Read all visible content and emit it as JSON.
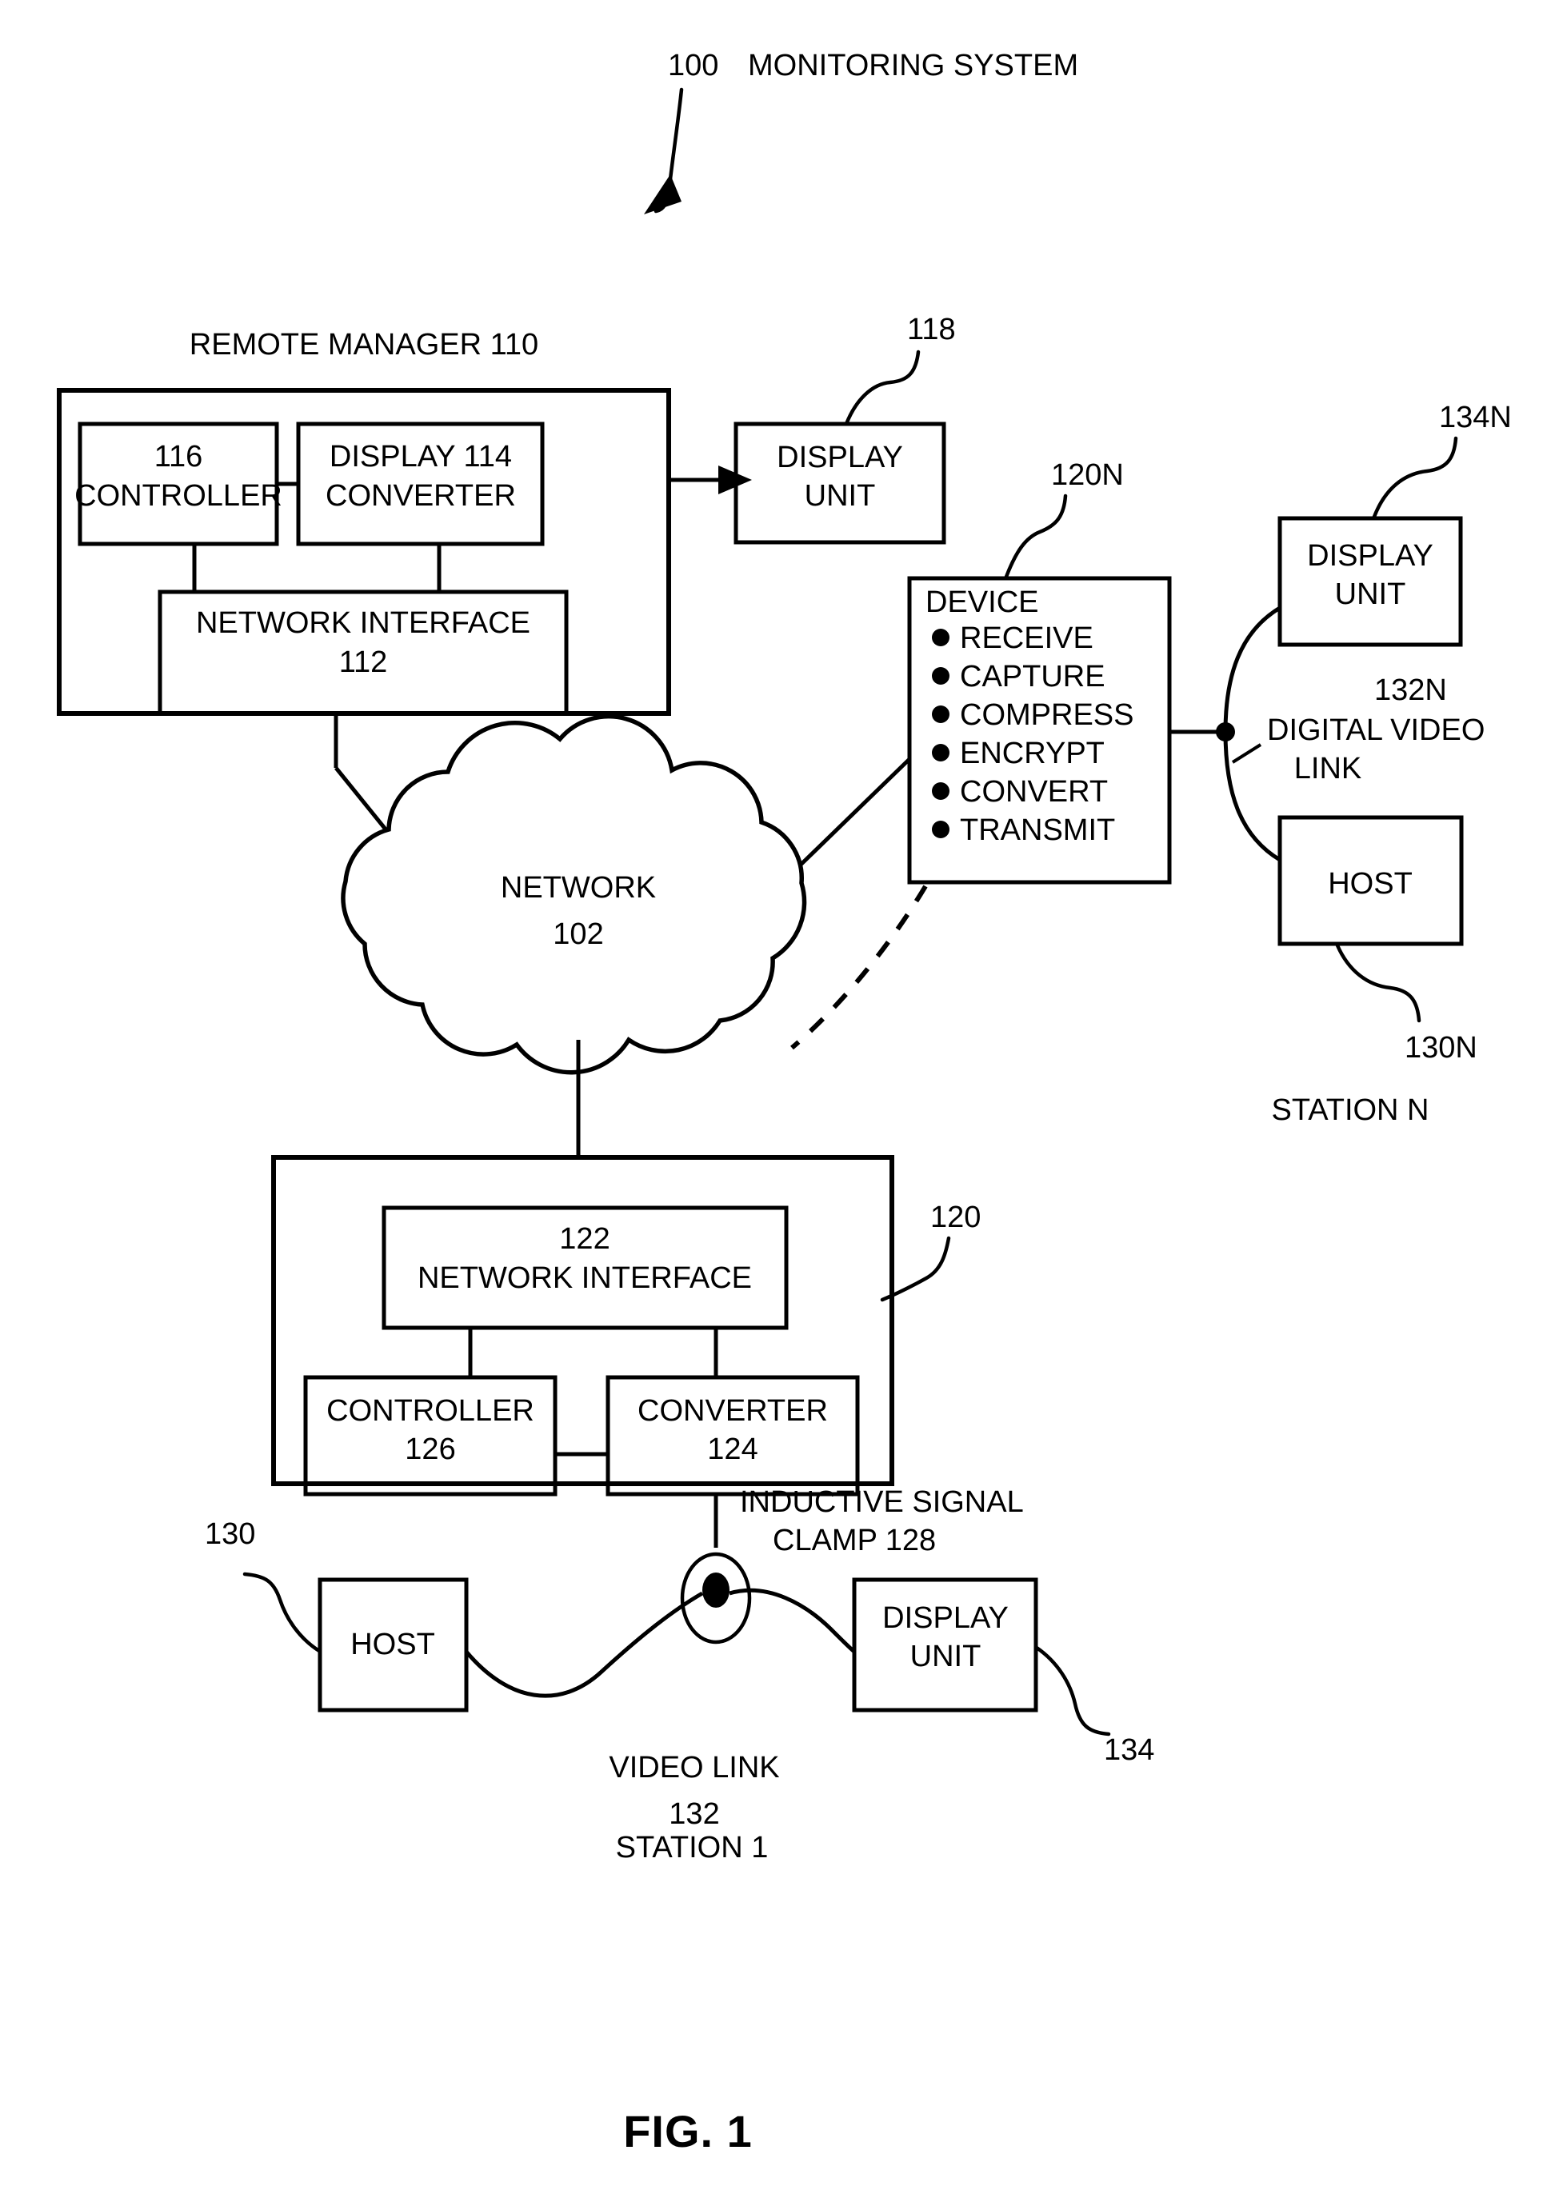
{
  "figure": {
    "caption": "FIG. 1",
    "title_ref": "100",
    "title_text": "MONITORING SYSTEM"
  },
  "remote_manager": {
    "heading": "REMOTE MANAGER 110",
    "controller": {
      "ref": "116",
      "label": "CONTROLLER"
    },
    "display_converter": {
      "label_top": "DISPLAY 114",
      "label_bottom": "CONVERTER"
    },
    "network_interface": {
      "label": "NETWORK INTERFACE",
      "ref": "112"
    }
  },
  "display_unit_118": {
    "line1": "DISPLAY",
    "line2": "UNIT",
    "ref": "118"
  },
  "network": {
    "label": "NETWORK",
    "ref": "102"
  },
  "device": {
    "ref": "120N",
    "title": "DEVICE",
    "functions": [
      "RECEIVE",
      "CAPTURE",
      "COMPRESS",
      "ENCRYPT",
      "CONVERT",
      "TRANSMIT"
    ]
  },
  "station_n": {
    "label": "STATION N",
    "display_unit": {
      "line1": "DISPLAY",
      "line2": "UNIT",
      "ref": "134N"
    },
    "host": {
      "label": "HOST",
      "ref": "130N"
    },
    "link": {
      "ref": "132N",
      "line1": "DIGITAL VIDEO",
      "line2": "LINK"
    }
  },
  "station_1": {
    "label": "STATION 1",
    "box_ref": "120",
    "network_interface": {
      "ref": "122",
      "label": "NETWORK INTERFACE"
    },
    "controller": {
      "label": "CONTROLLER",
      "ref": "126"
    },
    "converter": {
      "label": "CONVERTER",
      "ref": "124"
    },
    "host": {
      "label": "HOST",
      "ref": "130"
    },
    "display_unit": {
      "line1": "DISPLAY",
      "line2": "UNIT",
      "ref": "134"
    },
    "clamp": {
      "line1": "INDUCTIVE SIGNAL",
      "line2": "CLAMP 128"
    },
    "video_link": {
      "line1": "VIDEO LINK",
      "line2": "132"
    }
  },
  "colors": {
    "ink": "#000000",
    "paper": "#ffffff"
  }
}
